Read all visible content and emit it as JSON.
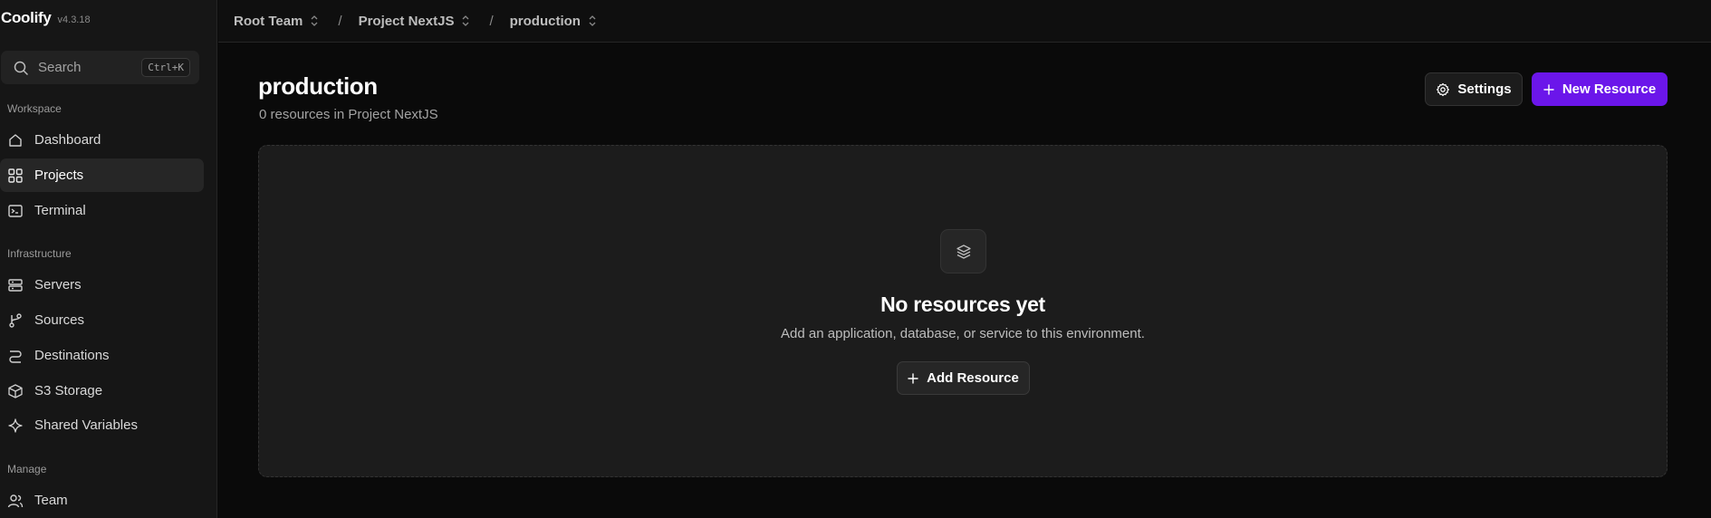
{
  "app": {
    "name": "Coolify",
    "version": "v4.3.18"
  },
  "search": {
    "label": "Search",
    "shortcut": "Ctrl+K"
  },
  "sidebar": {
    "sections": [
      {
        "label": "Workspace",
        "items": [
          {
            "label": "Dashboard",
            "icon": "home-icon"
          },
          {
            "label": "Projects",
            "icon": "grid-icon",
            "active": true
          },
          {
            "label": "Terminal",
            "icon": "terminal-icon"
          }
        ]
      },
      {
        "label": "Infrastructure",
        "items": [
          {
            "label": "Servers",
            "icon": "server-icon"
          },
          {
            "label": "Sources",
            "icon": "git-branch-icon"
          },
          {
            "label": "Destinations",
            "icon": "route-icon"
          },
          {
            "label": "S3 Storage",
            "icon": "box-icon"
          },
          {
            "label": "Shared Variables",
            "icon": "sparkle-icon"
          }
        ]
      },
      {
        "label": "Manage",
        "items": [
          {
            "label": "Team",
            "icon": "users-icon"
          }
        ]
      }
    ]
  },
  "breadcrumb": {
    "team": "Root Team",
    "project": "Project NextJS",
    "environment": "production",
    "separator": "/"
  },
  "page": {
    "title": "production",
    "subtitle": "0 resources in Project NextJS"
  },
  "actions": {
    "settings": "Settings",
    "new_resource": "New Resource"
  },
  "empty_state": {
    "title": "No resources yet",
    "description": "Add an application, database, or service to this environment.",
    "button": "Add Resource"
  },
  "colors": {
    "accent": "#6b16ea",
    "background": "#0a0a0a",
    "sidebar": "#161616",
    "card": "#1c1c1c"
  }
}
